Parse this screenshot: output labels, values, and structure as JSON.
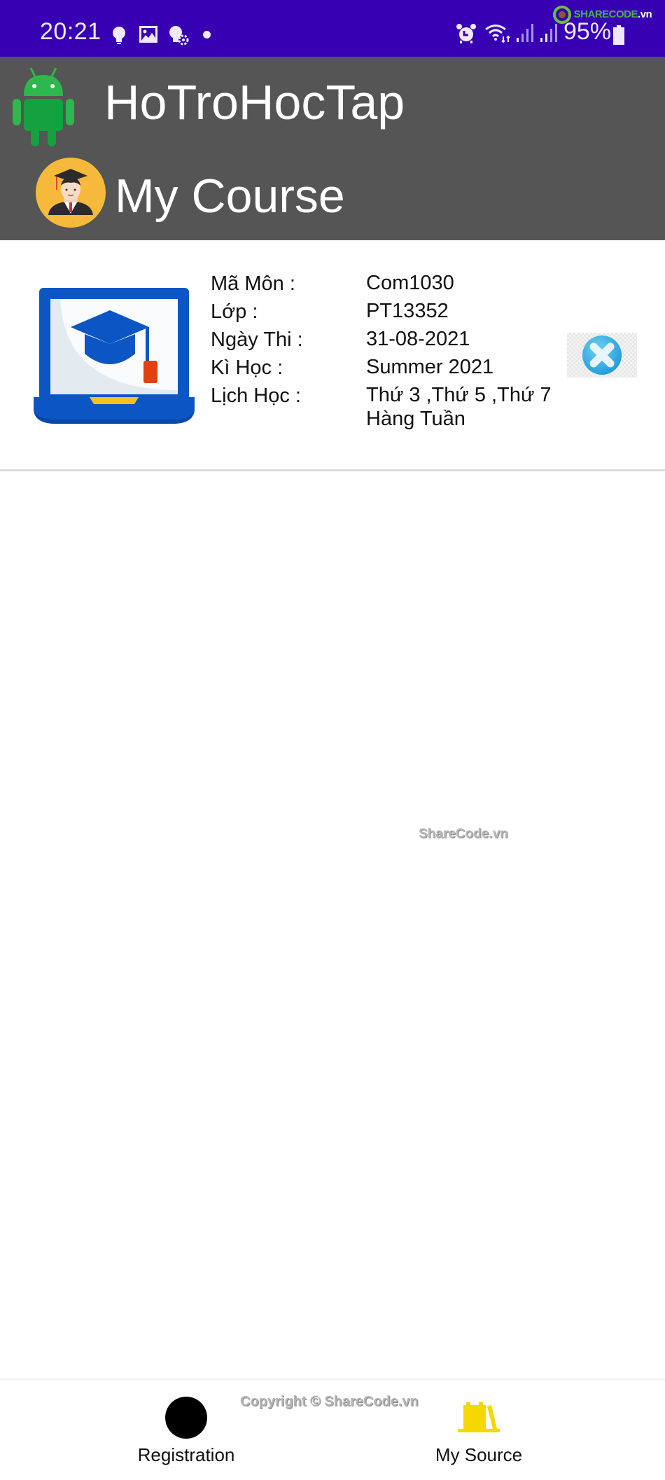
{
  "status_bar": {
    "time": "20:21",
    "left_icons": [
      "lightbulb-icon",
      "image-icon",
      "lightbulb-gear-icon",
      "dot-icon"
    ],
    "right_icons": [
      "alarm-icon",
      "wifi-icon",
      "signal-icon",
      "signal-icon"
    ],
    "battery_percent": "95%",
    "watermark_logo": {
      "brand": "SHARECODE",
      "suffix": ".vn"
    }
  },
  "app_bar": {
    "app_icon": "android-icon",
    "app_title": "HoTroHocTap",
    "page_icon": "graduate-avatar-icon",
    "page_title": "My Course"
  },
  "course": {
    "image": "laptop-graduation-cap-icon",
    "fields": [
      {
        "label": "Mã Môn :",
        "value": "Com1030"
      },
      {
        "label": "Lớp :",
        "value": "PT13352"
      },
      {
        "label": "Ngày Thi :",
        "value": "31-08-2021"
      },
      {
        "label": "Kì Học :",
        "value": "Summer 2021"
      },
      {
        "label": "Lịch Học :",
        "value": "Thứ 3 ,Thứ 5 ,Thứ 7\nHàng Tuần"
      }
    ],
    "schedule_line1": "Thứ 3 ,Thứ 5 ,Thứ 7",
    "schedule_line2": "Hàng Tuần",
    "delete_icon": "close-circle-icon"
  },
  "watermark": "ShareCode.vn",
  "bottom_nav": {
    "copyright": "Copyright © ShareCode.vn",
    "items": [
      {
        "label": "Registration",
        "icon": "circle-icon"
      },
      {
        "label": "My Source",
        "icon": "books-icon",
        "color": "#f5d800"
      }
    ]
  },
  "colors": {
    "status_bar": "#3700b3",
    "app_bar": "#555555",
    "close_button": "#3bb0e6"
  }
}
